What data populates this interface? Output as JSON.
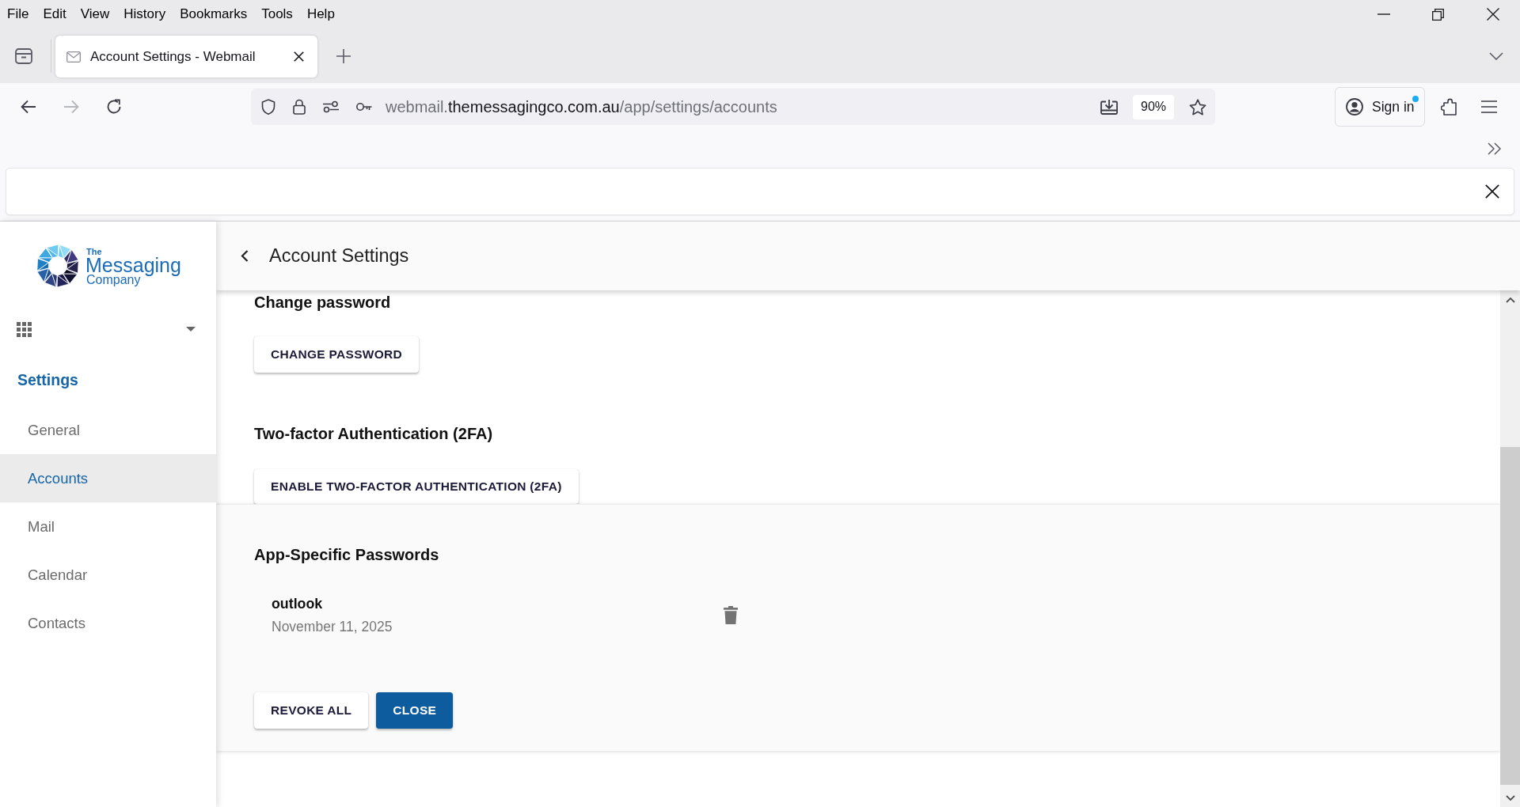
{
  "menu_bar": [
    {
      "label": "File"
    },
    {
      "label": "Edit"
    },
    {
      "label": "View"
    },
    {
      "label": "History"
    },
    {
      "label": "Bookmarks"
    },
    {
      "label": "Tools"
    },
    {
      "label": "Help"
    }
  ],
  "tabs": [
    {
      "title": "Account Settings - Webmail",
      "selected": true
    }
  ],
  "navigation": [
    {
      "kind": "back",
      "disabled": false
    },
    {
      "kind": "forward",
      "disabled": true
    },
    {
      "kind": "reload",
      "disabled": false
    }
  ],
  "address_bar": {
    "url_prefix": "webmail.",
    "url_domain": "themessagingco.com.au",
    "url_path": "/app/settings/accounts",
    "zoom": "90%"
  },
  "account_button": {
    "label": "Sign in",
    "badge": true
  },
  "sidebar": {
    "logo": [
      "The",
      "Messaging",
      "Company"
    ],
    "section_title": "Settings",
    "items": [
      {
        "label": "General",
        "selected": false
      },
      {
        "label": "Accounts",
        "selected": true
      },
      {
        "label": "Mail",
        "selected": false
      },
      {
        "label": "Calendar",
        "selected": false
      },
      {
        "label": "Contacts",
        "selected": false
      }
    ]
  },
  "header": {
    "title": "Account Settings"
  },
  "change_password": {
    "heading": "Change password",
    "button": "CHANGE PASSWORD"
  },
  "two_factor": {
    "heading": "Two-factor Authentication (2FA)",
    "button": "ENABLE TWO-FACTOR AUTHENTICATION (2FA)"
  },
  "app_passwords": {
    "heading": "App-Specific Passwords",
    "entries": [
      {
        "name": "outlook",
        "date": "November 11, 2025"
      }
    ],
    "buttons": [
      {
        "label": "REVOKE ALL",
        "primary": false
      },
      {
        "label": "CLOSE",
        "primary": true
      }
    ]
  }
}
